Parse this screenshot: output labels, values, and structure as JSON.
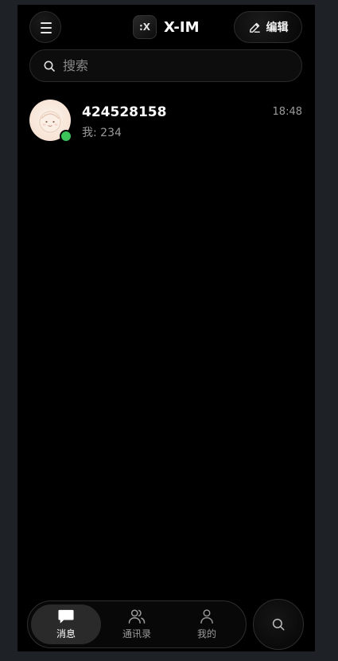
{
  "header": {
    "menu_icon": "hamburger-menu-icon",
    "logo_mark": ":X",
    "title": "X-IM",
    "edit_label": "编辑",
    "edit_icon": "pencil-icon"
  },
  "search": {
    "placeholder": "搜索",
    "icon": "search-icon"
  },
  "conversations": [
    {
      "name": "424528158",
      "last_message": "我: 234",
      "time": "18:48",
      "online": true,
      "status_color": "#3cc35a"
    }
  ],
  "tabs": [
    {
      "label": "消息",
      "icon": "chat-bubble-icon",
      "active": true
    },
    {
      "label": "通讯录",
      "icon": "contacts-icon",
      "active": false
    },
    {
      "label": "我的",
      "icon": "person-icon",
      "active": false
    }
  ],
  "fab": {
    "icon": "search-icon"
  }
}
